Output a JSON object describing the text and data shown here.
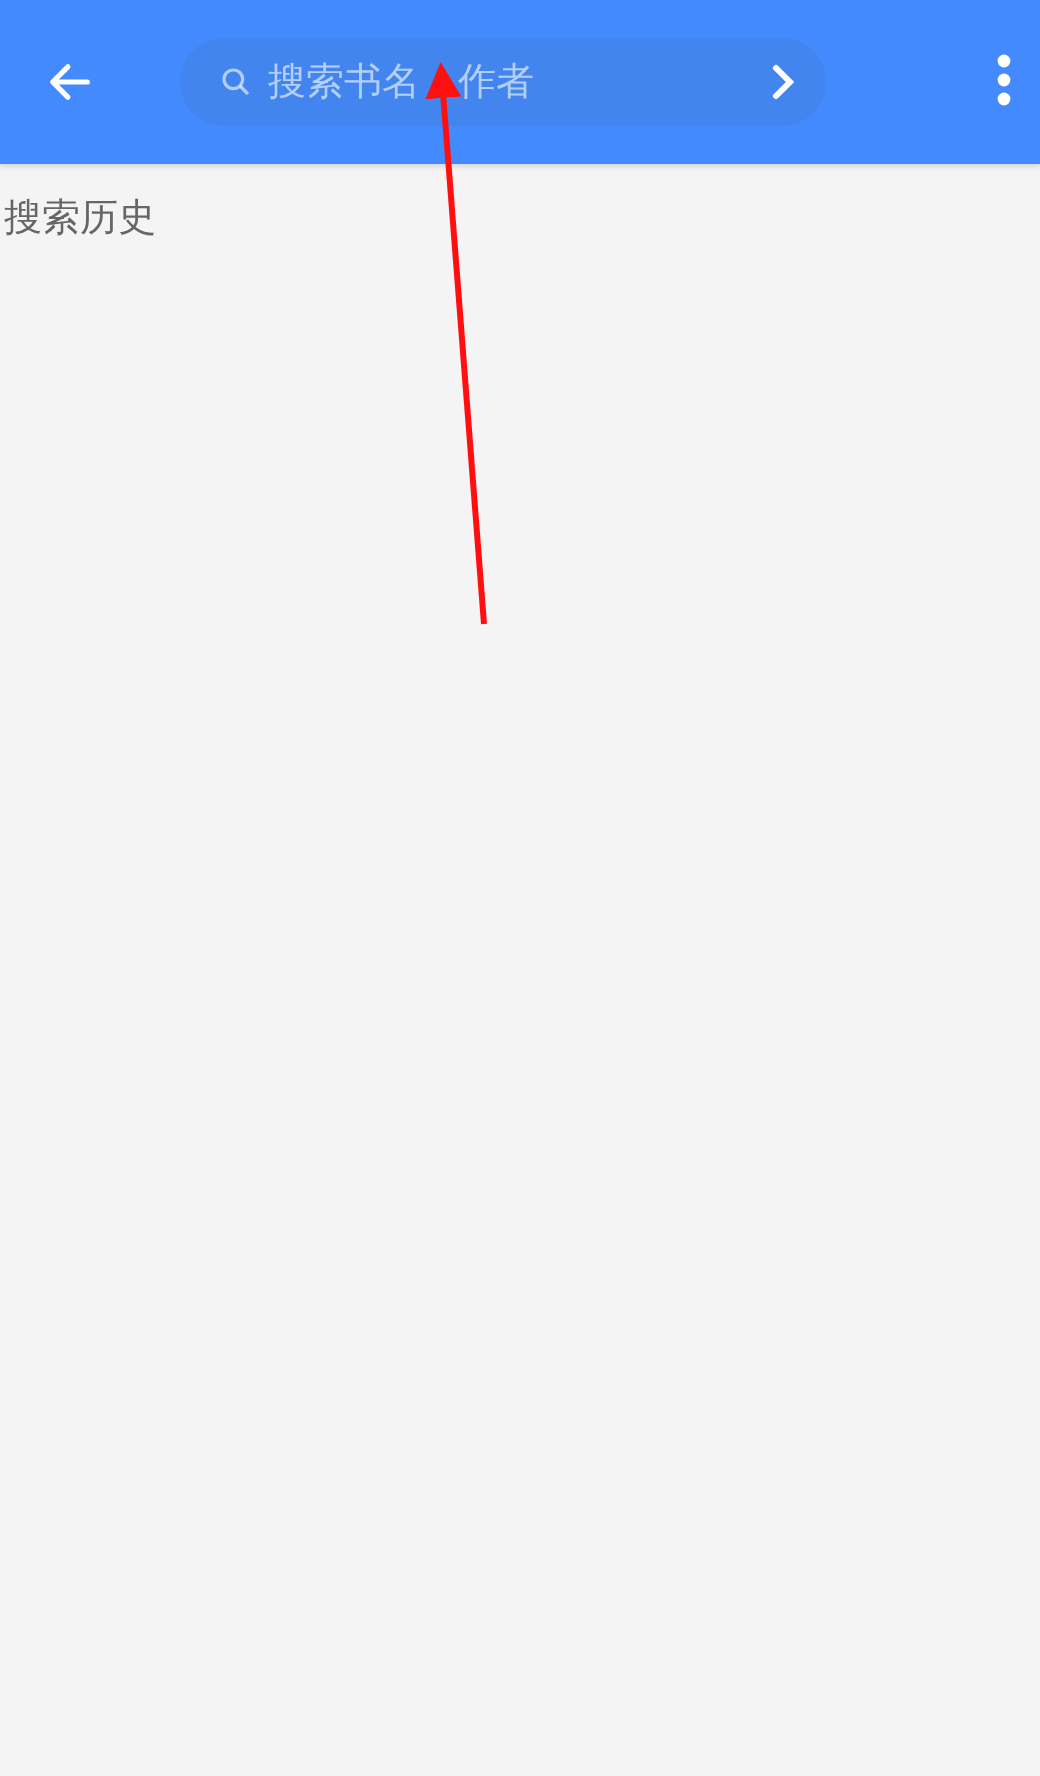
{
  "toolbar": {
    "search": {
      "placeholder": "搜索书名　作者"
    }
  },
  "section_title": "搜索历史",
  "annotation": {
    "kind": "arrow"
  }
}
